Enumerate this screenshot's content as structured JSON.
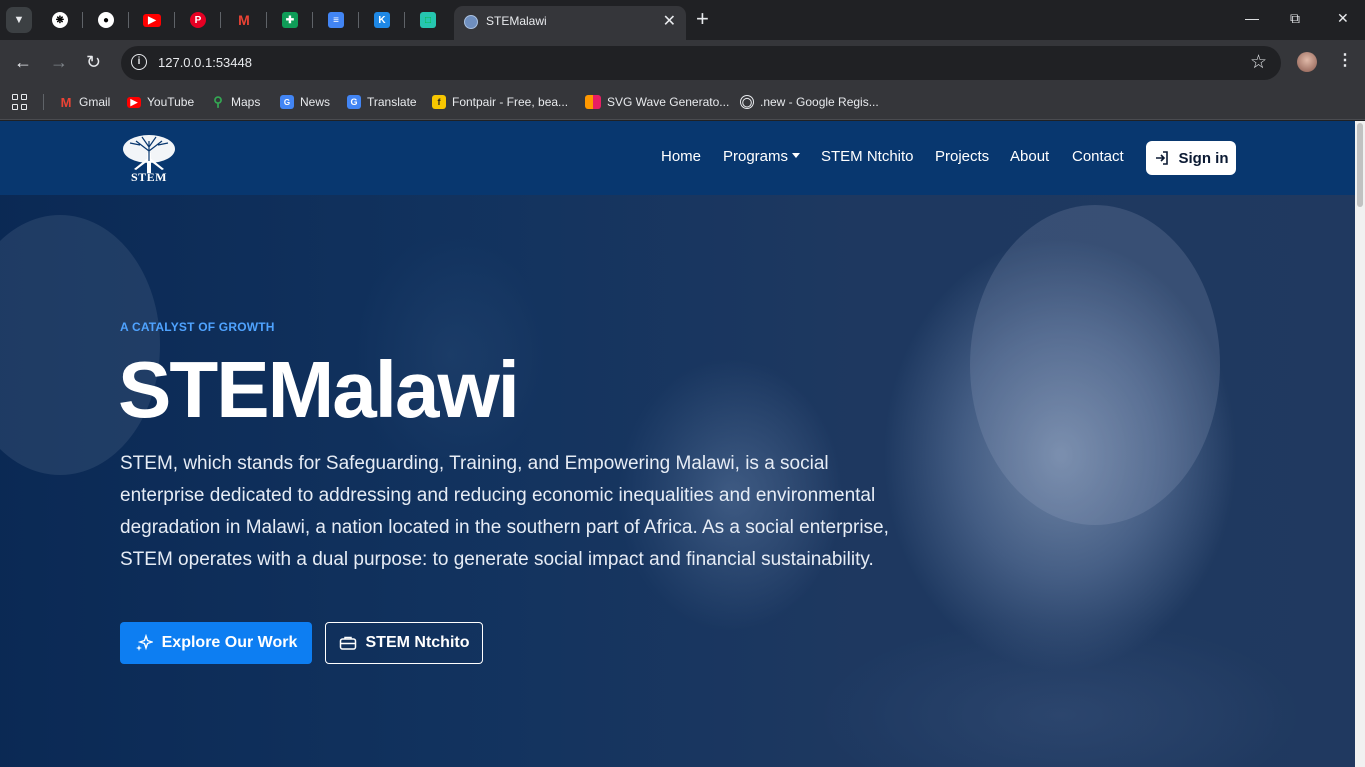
{
  "browser": {
    "active_tab_title": "STEMalawi",
    "url": "127.0.0.1:53448",
    "bookmarks": [
      {
        "label": "Gmail",
        "icon": "gmail-icon"
      },
      {
        "label": "YouTube",
        "icon": "youtube-icon"
      },
      {
        "label": "Maps",
        "icon": "maps-icon"
      },
      {
        "label": "News",
        "icon": "news-icon"
      },
      {
        "label": "Translate",
        "icon": "translate-icon"
      },
      {
        "label": "Fontpair - Free, bea...",
        "icon": "fontpair-icon"
      },
      {
        "label": "SVG Wave Generato...",
        "icon": "svg-wave-icon"
      },
      {
        "label": ".new - Google Regis...",
        "icon": "globe-icon"
      }
    ],
    "pinned_tabs": [
      "chatgpt-icon",
      "github-icon",
      "youtube-icon",
      "pinterest-icon",
      "gmail-icon",
      "sheets-icon",
      "docs-icon",
      "app-icon",
      "app-icon"
    ]
  },
  "site": {
    "logo_text": "STEM",
    "nav": {
      "home": "Home",
      "programs": "Programs",
      "ntchito": "STEM Ntchito",
      "projects": "Projects",
      "about": "About",
      "contact": "Contact",
      "signin": "Sign in"
    },
    "hero": {
      "kicker": "A CATALYST OF GROWTH",
      "title": "STEMalawi",
      "description": "STEM, which stands for Safeguarding, Training, and Empowering Malawi, is a social enterprise dedicated to addressing and reducing economic inequalities and environmental degradation in Malawi, a nation located in the southern part of Africa. As a social enterprise, STEM operates with a dual purpose: to generate social impact and financial sustainability.",
      "primary_button": "Explore Our Work",
      "secondary_button": "STEM Ntchito"
    }
  },
  "colors": {
    "navbar": "#08376f",
    "accent": "#0d7ef2",
    "kicker": "#4fa3ff"
  }
}
